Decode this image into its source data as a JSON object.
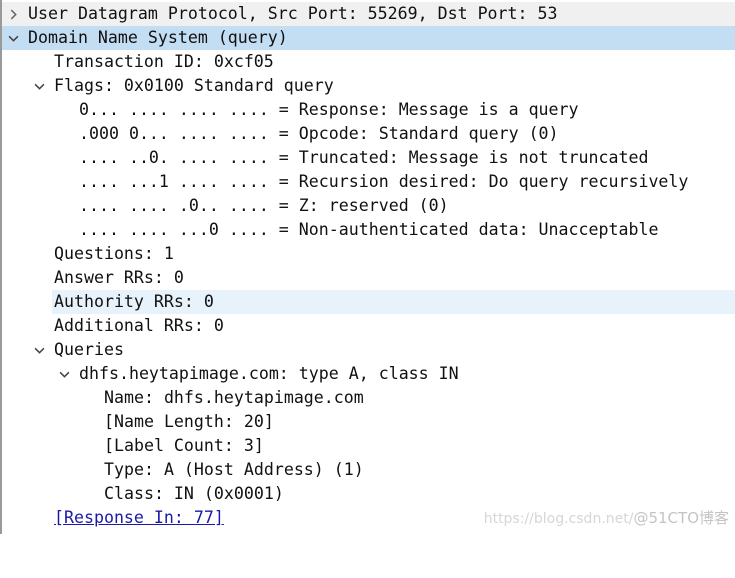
{
  "packet_details": {
    "udp": {
      "label": "User Datagram Protocol, Src Port: 55269, Dst Port: 53",
      "expanded": false
    },
    "dns": {
      "label": "Domain Name System (query)",
      "expanded": true,
      "transaction_id": "Transaction ID: 0xcf05",
      "flags": {
        "label": "Flags: 0x0100 Standard query",
        "expanded": true,
        "bits": [
          "0... .... .... .... = Response: Message is a query",
          ".000 0... .... .... = Opcode: Standard query (0)",
          ".... ..0. .... .... = Truncated: Message is not truncated",
          ".... ...1 .... .... = Recursion desired: Do query recursively",
          ".... .... .0.. .... = Z: reserved (0)",
          ".... .... ...0 .... = Non-authenticated data: Unacceptable"
        ]
      },
      "questions": "Questions: 1",
      "answer_rrs": "Answer RRs: 0",
      "authority_rrs": "Authority RRs: 0",
      "additional_rrs": "Additional RRs: 0",
      "queries": {
        "label": "Queries",
        "expanded": true,
        "items": [
          {
            "label": "dhfs.heytapimage.com: type A, class IN",
            "expanded": true,
            "fields": [
              "Name: dhfs.heytapimage.com",
              "[Name Length: 20]",
              "[Label Count: 3]",
              "Type: A (Host Address) (1)",
              "Class: IN (0x0001)"
            ]
          }
        ]
      },
      "response_in": "[Response In: 77]"
    }
  },
  "watermark": {
    "url": "https://blog.csdn.net/",
    "brand": "@51CTO博客"
  },
  "colors": {
    "selected_row": "#c3ddf3",
    "hover_row": "#e8f2fb",
    "link": "#1a1aa6"
  }
}
